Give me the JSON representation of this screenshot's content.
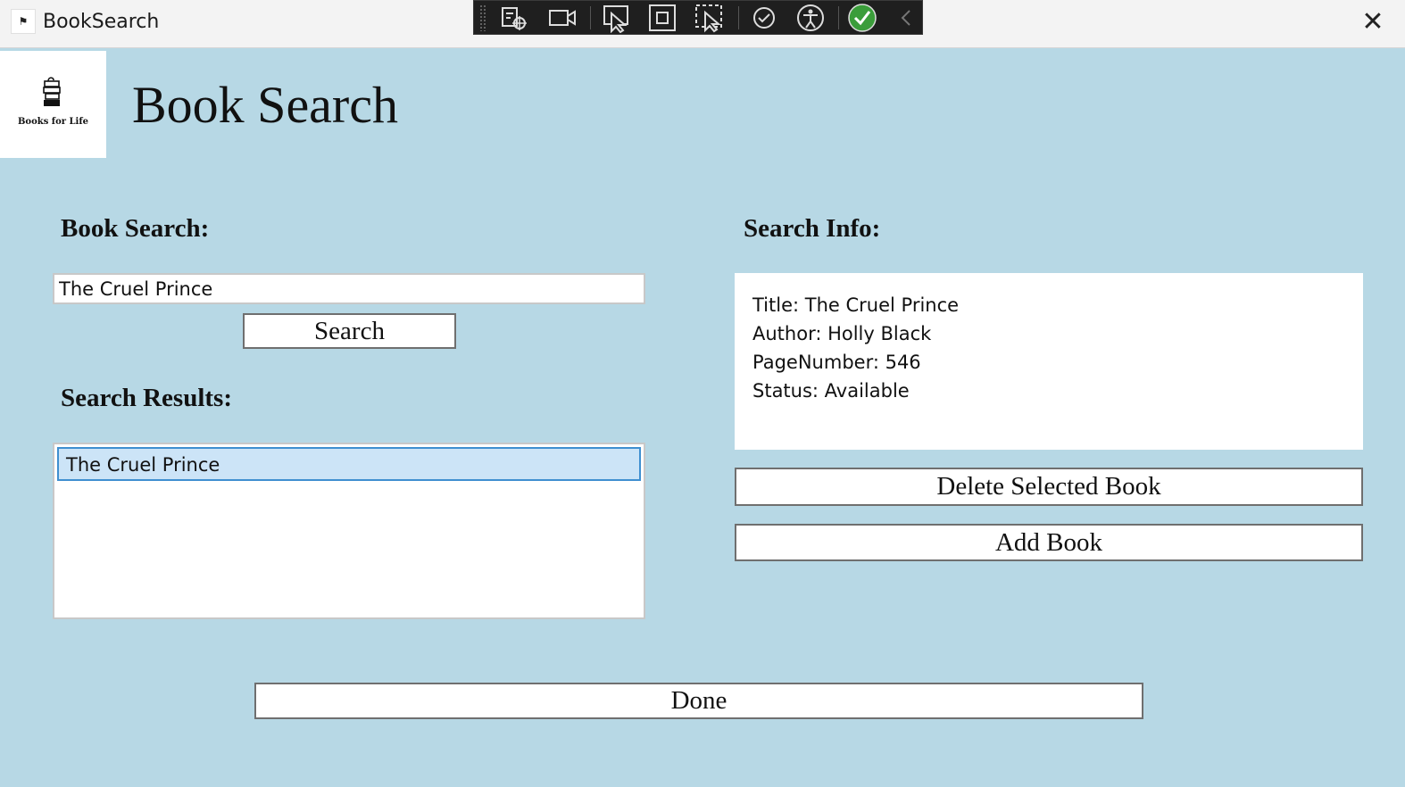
{
  "window": {
    "title": "BookSearch",
    "close_glyph": "✕"
  },
  "logo": {
    "text": "Books for Life"
  },
  "page": {
    "title": "Book Search"
  },
  "search": {
    "label": "Book Search:",
    "value": "The Cruel Prince",
    "button": "Search"
  },
  "results": {
    "label": "Search Results:",
    "items": [
      "The Cruel Prince"
    ]
  },
  "info": {
    "label": "Search Info:",
    "lines": [
      "Title: The Cruel Prince",
      "Author: Holly Black",
      "PageNumber: 546",
      "Status: Available"
    ]
  },
  "actions": {
    "delete": "Delete Selected Book",
    "add": "Add Book",
    "done": "Done"
  },
  "colors": {
    "background": "#b7d8e5",
    "selection": "#cce4f7",
    "selection_border": "#3f8fd0"
  }
}
